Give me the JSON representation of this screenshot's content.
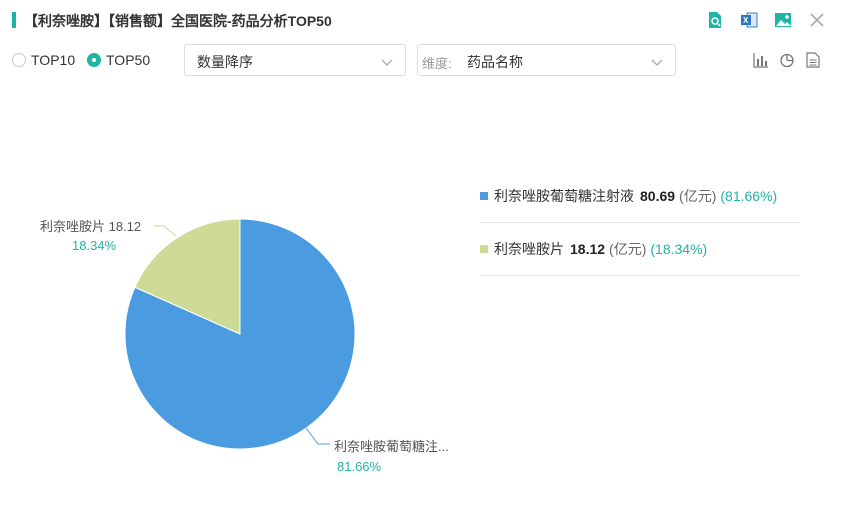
{
  "header": {
    "title": "【利奈唑胺】【销售额】全国医院-药品分析TOP50",
    "accent_color": "#1fb5a5",
    "icons": [
      "preview-icon",
      "excel-export-icon",
      "image-export-icon",
      "close-icon"
    ]
  },
  "toolbar": {
    "radio_options": [
      {
        "label": "TOP10",
        "checked": false
      },
      {
        "label": "TOP50",
        "checked": true
      }
    ],
    "sort_select": {
      "value": "数量降序"
    },
    "dimension_select": {
      "prefix": "维度:",
      "value": "药品名称"
    },
    "view_icons": [
      "bar-chart-icon",
      "pie-chart-icon",
      "table-icon"
    ]
  },
  "legend": {
    "unit": "(亿元)",
    "items": [
      {
        "name": "利奈唑胺葡萄糖注射液",
        "value": "80.69",
        "pct": "(81.66%)"
      },
      {
        "name": "利奈唑胺片",
        "value": "18.12",
        "pct": "(18.34%)"
      }
    ]
  },
  "pie_labels": [
    {
      "name": "利奈唑胺片 18.12",
      "pct": "18.34%"
    },
    {
      "name": "利奈唑胺葡萄糖注...",
      "pct": "81.66%"
    }
  ],
  "chart_data": {
    "type": "pie",
    "unit": "亿元",
    "categories": [
      "利奈唑胺葡萄糖注射液",
      "利奈唑胺片"
    ],
    "values": [
      80.69,
      18.12
    ],
    "percentages": [
      81.66,
      18.34
    ],
    "colors": [
      "#4a9be0",
      "#cedb96"
    ],
    "legend_position": "right"
  }
}
